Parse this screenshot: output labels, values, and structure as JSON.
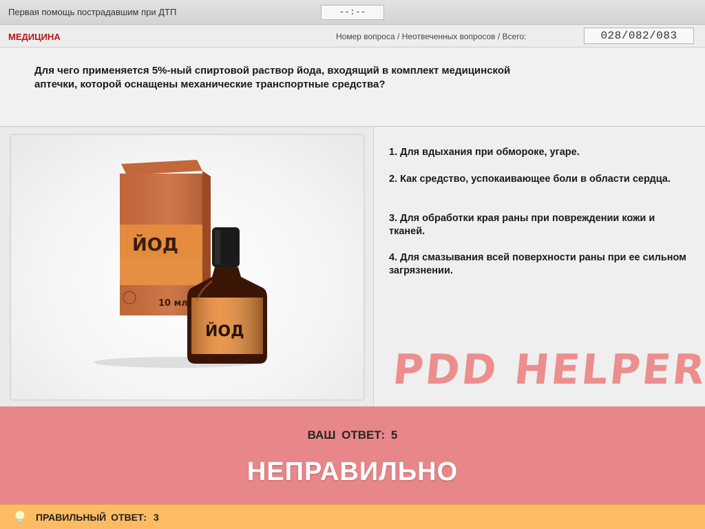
{
  "header": {
    "title": "Первая помощь пострадавшим при ДТП",
    "timer": "--:--"
  },
  "info": {
    "category": "МЕДИЦИНА",
    "counter_label": "Номер вопроса / Неотвеченных вопросов / Всего:",
    "counter_value": "028/082/083"
  },
  "question": {
    "line1": "Для чего применяется 5%-ный спиртовой раствор йода, входящий в комплект медицинской",
    "line2": "аптечки, которой оснащены механические транспортные средства?"
  },
  "image": {
    "box_label": "ЙОД",
    "box_volume": "10 мл",
    "bottle_label": "ЙОД"
  },
  "answers": [
    {
      "text": "1.  Для вдыхания при обмороке, угаре."
    },
    {
      "text": "2.  Как средство, успокаивающее боли в области сердца."
    },
    {
      "text": "3.  Для обработки края раны при повреждении кожи и тканей."
    },
    {
      "text": "4.  Для смазывания всей поверхности раны при ее сильном загрязнении."
    }
  ],
  "watermark": "PDD HELPER",
  "result": {
    "your_answer_label": "ВАШ  ОТВЕТ:",
    "your_answer_value": "5",
    "verdict": "НЕПРАВИЛЬНО"
  },
  "correct": {
    "label": "ПРАВИЛЬНЫЙ ОТВЕТ:",
    "value": "3"
  },
  "colors": {
    "category": "#b01818",
    "result_bg": "#e8878a",
    "correct_bar_bg": "#fdbc63",
    "watermark": "#ec8e8e"
  }
}
